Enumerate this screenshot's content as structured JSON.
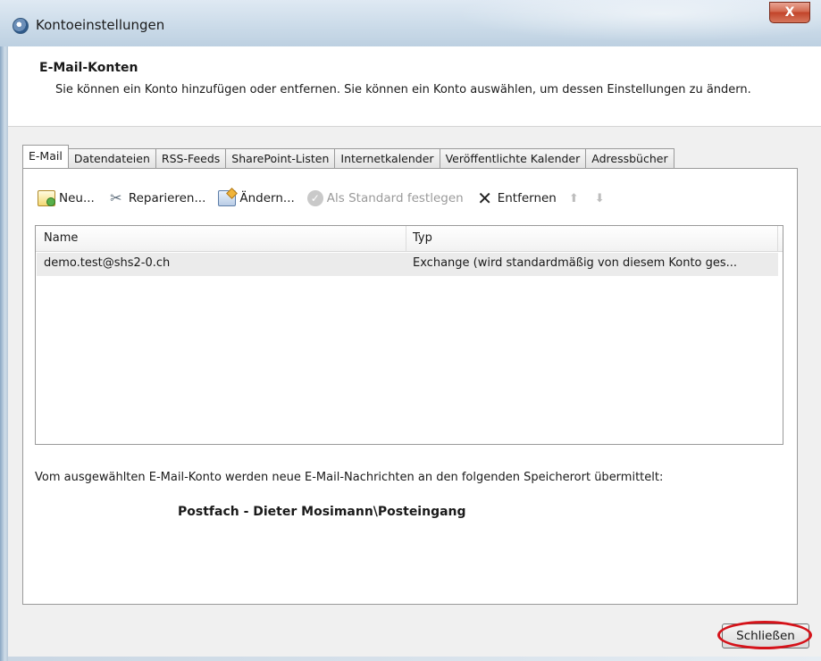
{
  "window": {
    "title": "Kontoeinstellungen",
    "close_glyph": "X"
  },
  "header": {
    "title": "E-Mail-Konten",
    "description": "Sie können ein Konto hinzufügen oder entfernen. Sie können ein Konto auswählen, um dessen Einstellungen zu ändern."
  },
  "tabs": [
    {
      "label": "E-Mail",
      "active": true
    },
    {
      "label": "Datendateien",
      "active": false
    },
    {
      "label": "RSS-Feeds",
      "active": false
    },
    {
      "label": "SharePoint-Listen",
      "active": false
    },
    {
      "label": "Internetkalender",
      "active": false
    },
    {
      "label": "Veröffentlichte Kalender",
      "active": false
    },
    {
      "label": "Adressbücher",
      "active": false
    }
  ],
  "toolbar": {
    "new_label": "Neu...",
    "repair_label": "Reparieren...",
    "change_label": "Ändern...",
    "set_default_label": "Als Standard festlegen",
    "remove_label": "Entfernen",
    "up_glyph": "⬆",
    "down_glyph": "⬇",
    "icons": [
      "new-account-icon",
      "repair-icon",
      "change-icon",
      "set-default-icon",
      "remove-icon",
      "move-up-icon",
      "move-down-icon"
    ]
  },
  "accounts": {
    "columns": {
      "name": "Name",
      "type": "Typ"
    },
    "rows": [
      {
        "name": "demo.test@shs2-0.ch",
        "type": "Exchange (wird standardmäßig von diesem Konto ges..."
      }
    ]
  },
  "delivery": {
    "label": "Vom ausgewählten E-Mail-Konto werden neue E-Mail-Nachrichten an den folgenden Speicherort übermittelt:",
    "location": "Postfach - Dieter Mosimann\\Posteingang"
  },
  "footer": {
    "close_label": "Schließen",
    "highlight_color": "#d5131a"
  }
}
